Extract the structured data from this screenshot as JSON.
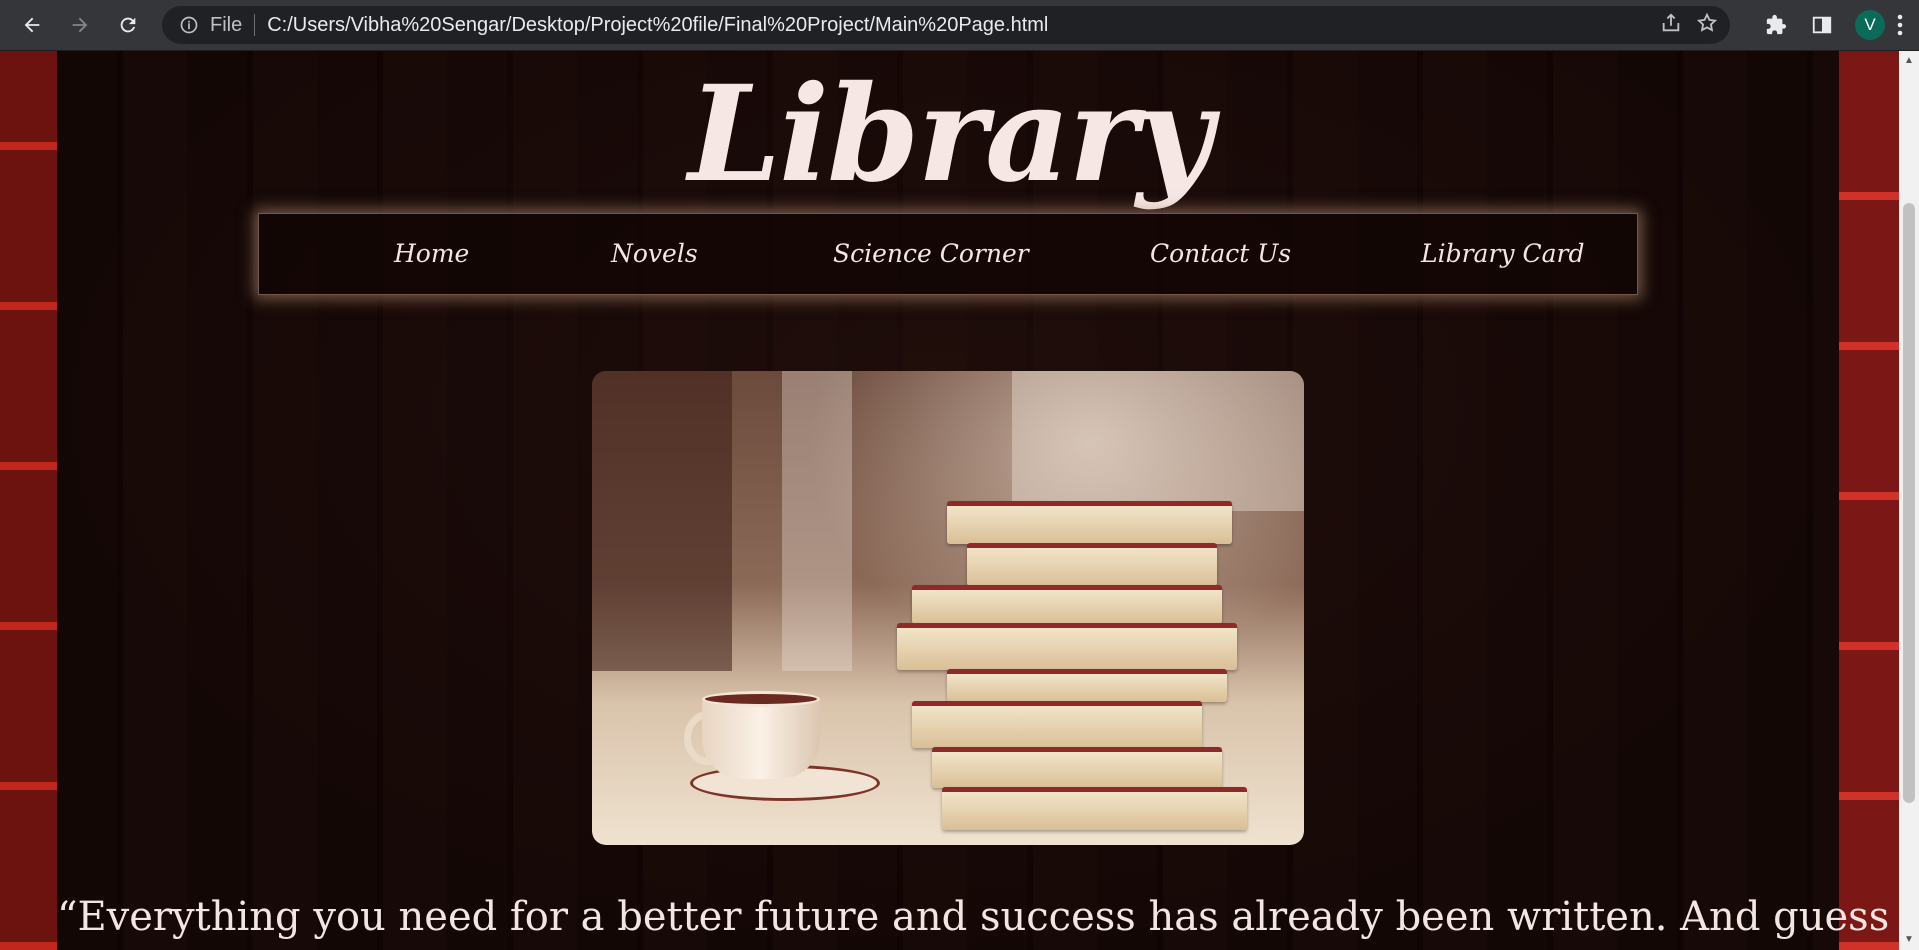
{
  "browser": {
    "file_label": "File",
    "url": "C:/Users/Vibha%20Sengar/Desktop/Project%20file/Final%20Project/Main%20Page.html",
    "profile_initial": "V",
    "profile_color": "#0b6b59"
  },
  "page": {
    "title": "Library",
    "nav": [
      {
        "label": "Home"
      },
      {
        "label": "Novels"
      },
      {
        "label": "Science Corner"
      },
      {
        "label": "Contact Us"
      },
      {
        "label": "Library Card"
      }
    ],
    "hero_image": "books-and-coffee-cup",
    "quote": "“Everything you need for a better future and success has already been written. And guess what?"
  },
  "colors": {
    "accent_red": "#b8271f",
    "nav_glow": "#be9678",
    "text_light": "#f3e6e2"
  }
}
